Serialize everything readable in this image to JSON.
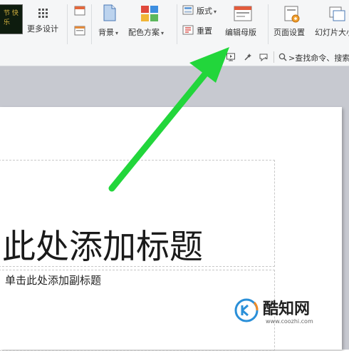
{
  "ribbon": {
    "more_design": "更多设计",
    "background": "背景",
    "color_scheme": "配色方案",
    "layout": "版式",
    "reset": "重置",
    "edit_master": "编辑母版",
    "page_setup": "页面设置",
    "slide_size": "幻灯片大小",
    "theme_thumb_text": "节 快乐"
  },
  "subbar": {
    "search_placeholder": ">查找命令、搜索"
  },
  "slide": {
    "title": "此处添加标题",
    "subtitle": "单击此处添加副标题"
  },
  "watermark": {
    "name": "酷知网",
    "url": "www.coozhi.com"
  },
  "colors": {
    "arrow": "#22d63b",
    "canvas": "#c7c9d0",
    "ribbon": "#f5f6f7"
  }
}
